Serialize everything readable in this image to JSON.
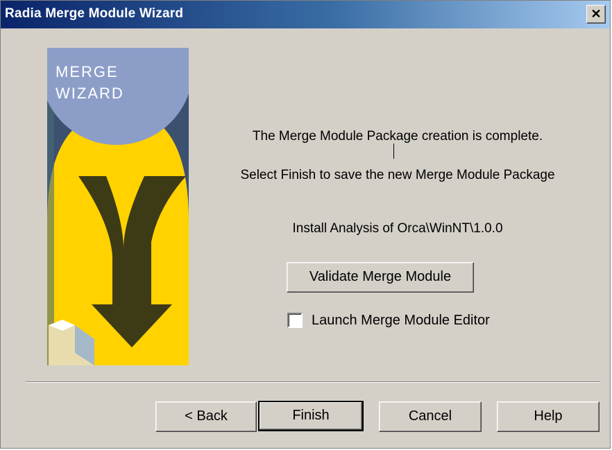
{
  "window": {
    "title": "Radia Merge Module Wizard",
    "close_glyph": "✕"
  },
  "art": {
    "line1": "MERGE",
    "line2": "WIZARD",
    "colors": {
      "navy": "#3c5070",
      "yellow": "#ffd200",
      "circle": "#8c9ec8",
      "arrow": "#3d3a16"
    }
  },
  "content": {
    "line1": "The Merge Module Package creation is complete.",
    "line2": "Select Finish to save the new Merge Module Package",
    "analysis": "Install Analysis of Orca\\WinNT\\1.0.0",
    "validate_label": "Validate Merge Module",
    "checkbox_label": "Launch Merge Module Editor",
    "checkbox_checked": false
  },
  "buttons": {
    "back": "< Back",
    "finish": "Finish",
    "cancel": "Cancel",
    "help": "Help"
  }
}
